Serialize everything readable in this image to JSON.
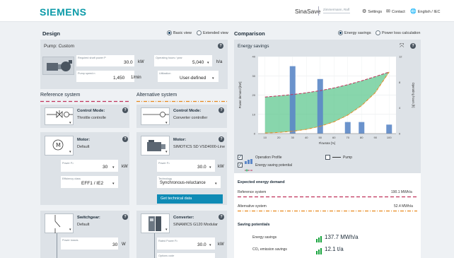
{
  "header": {
    "brand": "SIEMENS",
    "app_name": "SinaSave",
    "user_box": "Zimmermann, Ralf",
    "settings": "Settings",
    "contact": "Contact",
    "language": "English / IEC"
  },
  "design": {
    "title": "Design",
    "views": [
      "Basic view",
      "Extended view"
    ],
    "selected_view": "Basic view",
    "pump": {
      "title": "Pump: Custom",
      "shaft_power_label": "Required shaft power P",
      "shaft_power": "30.0",
      "shaft_power_unit": "kW",
      "op_hours_label": "Operating hours / year",
      "op_hours": "5,040",
      "op_hours_unit": "h/a",
      "speed_label": "Pump speed n",
      "speed": "1,450",
      "speed_unit": "1/min",
      "rel_label": "Utilization",
      "rel_value": "User-defined"
    }
  },
  "reference": {
    "title": "Reference system",
    "control": {
      "title": "Control Mode:",
      "value": "Throttle controlle"
    },
    "motor": {
      "title": "Motor:",
      "value": "Default",
      "power_label": "Power Pₙ",
      "power": "30",
      "power_unit": "kW",
      "eff_label": "Efficiency class",
      "eff": "EFF1 / IE2"
    },
    "switchgear": {
      "title": "Switchgear:",
      "value": "Default",
      "loss_label": "Power losses",
      "loss": "30",
      "loss_unit": "W"
    }
  },
  "alternative": {
    "title": "Alternative system",
    "control": {
      "title": "Control Mode:",
      "value": "Converter controller"
    },
    "motor": {
      "title": "Motor:",
      "value": "SIMOTICS SD VSD4000-Line",
      "power_label": "Power Pₙ",
      "power": "30.0",
      "power_unit": "kW",
      "tech_label": "Technology",
      "tech": "Synchronous-reluctance",
      "button": "Get technical data"
    },
    "converter": {
      "title": "Converter:",
      "value": "SINAMICS G120 Modular",
      "power_label": "Rated Power Pₙ",
      "power": "30.0",
      "power_unit": "kW",
      "extra_label": "Options code"
    }
  },
  "comparison": {
    "title": "Comparison",
    "views": [
      "Energy savings",
      "Power loss calculation"
    ],
    "selected_view": "Energy savings",
    "panel_title": "Energy savings",
    "legend": {
      "op_profile": "Operation Profile",
      "pump": "Pump",
      "saving": "Energy saving potential"
    },
    "expected_title": "Expected energy demand",
    "ref_label": "Reference system",
    "ref_value": "190.1 MWh/a",
    "alt_label": "Alternative system",
    "alt_value": "52.4 MWh/a",
    "potentials_title": "Saving potentials",
    "energy_label": "Energy savings",
    "energy_value": "137.7 MWh/a",
    "co2_label": "CO₂ emission savings",
    "co2_value": "12.1 t/a"
  },
  "colors": {
    "accent": "#0b9aa8",
    "navy": "#0f3b5f",
    "button": "#0f8bb5",
    "ref_dash": "#c0325a",
    "alt_dash": "#e8891d",
    "area": "#56c489",
    "bar": "#5b87c7"
  },
  "chart_data": {
    "type": "bar",
    "title": "",
    "xlabel": "Flowrate [%]",
    "ylabel": "Power demand [kW]",
    "y2label": "Operating hours [h]",
    "x_ticks": [
      10,
      20,
      30,
      40,
      50,
      60,
      70,
      80,
      90,
      100
    ],
    "xlim": [
      5,
      105
    ],
    "y_ticks": [
      0,
      10,
      20,
      30,
      40
    ],
    "ylim": [
      0,
      40
    ],
    "y2_ticks": [
      0,
      4,
      8,
      12
    ],
    "y2lim": [
      0,
      12
    ],
    "series": [
      {
        "name": "Operation Profile",
        "type": "bar",
        "axis": "y2",
        "x": [
          30,
          50,
          70,
          80,
          100
        ],
        "values": [
          10.5,
          8.5,
          1.8,
          1.8,
          1.4
        ]
      },
      {
        "name": "Reference system",
        "type": "line",
        "axis": "y",
        "x": [
          10,
          20,
          30,
          40,
          50,
          60,
          70,
          80,
          90,
          100
        ],
        "values": [
          19,
          19.6,
          20.3,
          21.2,
          22.3,
          23.7,
          25.4,
          27.4,
          29.6,
          32
        ]
      },
      {
        "name": "Alternative system",
        "type": "line",
        "axis": "y",
        "x": [
          10,
          20,
          30,
          40,
          50,
          60,
          70,
          80,
          90,
          100
        ],
        "values": [
          0.3,
          0.6,
          1.2,
          2.2,
          3.8,
          6.1,
          9.6,
          14.5,
          21.3,
          32
        ]
      }
    ]
  }
}
